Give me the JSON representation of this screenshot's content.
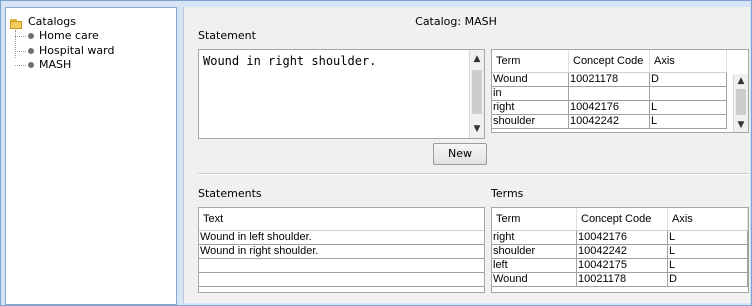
{
  "tree": {
    "root_label": "Catalogs",
    "items": [
      {
        "label": "Home care"
      },
      {
        "label": "Hospital ward"
      },
      {
        "label": "MASH"
      }
    ]
  },
  "main": {
    "catalog_title": "Catalog: MASH",
    "statement_label": "Statement",
    "statement_text": "Wound in right shoulder.",
    "new_button": "New",
    "statements_label": "Statements",
    "terms_label": "Terms"
  },
  "top_terms_table": {
    "headers": [
      "Term",
      "Concept Code",
      "Axis"
    ],
    "rows": [
      [
        "Wound",
        "10021178",
        "D"
      ],
      [
        "in",
        "",
        ""
      ],
      [
        "right",
        "10042176",
        "L"
      ],
      [
        "shoulder",
        "10042242",
        "L"
      ]
    ]
  },
  "statements_table": {
    "headers": [
      "Text"
    ],
    "rows": [
      [
        "Wound in left shoulder."
      ],
      [
        "Wound in right shoulder."
      ],
      [
        ""
      ],
      [
        ""
      ]
    ]
  },
  "terms_table": {
    "headers": [
      "Term",
      "Concept Code",
      "Axis"
    ],
    "rows": [
      [
        "right",
        "10042176",
        "L"
      ],
      [
        "shoulder",
        "10042242",
        "L"
      ],
      [
        "left",
        "10042175",
        "L"
      ],
      [
        "Wound",
        "10021178",
        "D"
      ]
    ]
  }
}
